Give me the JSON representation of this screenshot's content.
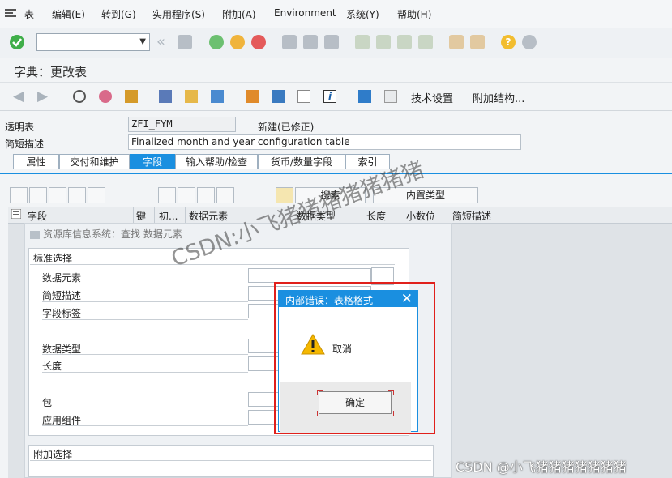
{
  "menu": {
    "items": [
      "表",
      "编辑(E)",
      "转到(G)",
      "实用程序(S)",
      "附加(A)",
      "Environment",
      "系统(Y)",
      "帮助(H)"
    ]
  },
  "toolbar": {
    "command_field_value": ""
  },
  "title": "字典：更改表",
  "app_toolbar": {
    "tech_settings_label": "技术设置",
    "append_structure_label": "附加结构..."
  },
  "header": {
    "transparent_table_label": "透明表",
    "table_name": "ZFI_FYM",
    "status": "新建(已修正)",
    "short_desc_label": "简短描述",
    "short_desc_value": "Finalized month and year configuration table"
  },
  "tabs": [
    {
      "label": "属性",
      "active": false
    },
    {
      "label": "交付和维护",
      "active": false
    },
    {
      "label": "字段",
      "active": true
    },
    {
      "label": "输入帮助/检查",
      "active": false
    },
    {
      "label": "货币/数量字段",
      "active": false
    },
    {
      "label": "索引",
      "active": false
    }
  ],
  "grid_toolbar": {
    "search_label": "搜索",
    "builtin_type_label": "内置类型"
  },
  "table": {
    "columns": [
      "字段",
      "键",
      "初...",
      "数据元素",
      "数据类型",
      "长度",
      "小数位",
      "简短描述"
    ]
  },
  "search_help": {
    "title": "资源库信息系统：查找 数据元素",
    "standard_selection_title": "标准选择",
    "fields": [
      "数据元素",
      "简短描述",
      "字段标签",
      "数据类型",
      "长度",
      "包",
      "应用组件"
    ],
    "additional_selection_title": "附加选择"
  },
  "error_dialog": {
    "title": "内部错误：表格格式",
    "message": "取消",
    "ok_label": "确定",
    "close_label": "✕"
  },
  "watermarks": {
    "diagonal": "CSDN:小飞猪猪猪猪猪猪猪",
    "corner": "CSDN @小飞猪猪猪猪猪猪猪"
  },
  "colors": {
    "accent": "#1a8fe0",
    "highlight_frame": "#e0201b",
    "warning": "#f5b800"
  }
}
